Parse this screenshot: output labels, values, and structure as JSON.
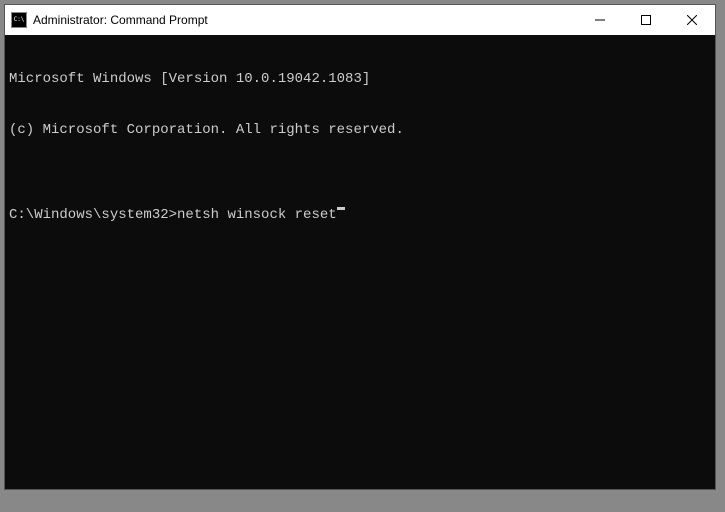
{
  "window": {
    "title": "Administrator: Command Prompt",
    "icon_glyph": "C:\\"
  },
  "terminal": {
    "line1": "Microsoft Windows [Version 10.0.19042.1083]",
    "line2": "(c) Microsoft Corporation. All rights reserved.",
    "blank": "",
    "prompt": "C:\\Windows\\system32>",
    "command": "netsh winsock reset"
  }
}
